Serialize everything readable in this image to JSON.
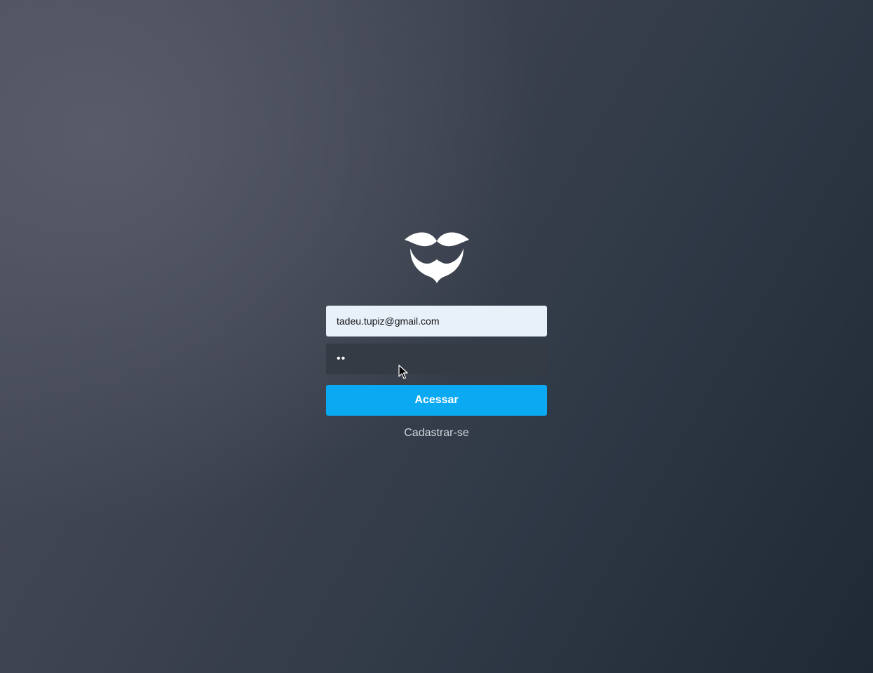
{
  "login": {
    "logo_icon": "mustache-beard-logo-icon",
    "email_value": "tadeu.tupiz@gmail.com",
    "password_value": "ab",
    "submit_label": "Acessar",
    "register_label": "Cadastrar-se"
  },
  "colors": {
    "accent": "#0ba9f2",
    "email_bg": "#e8f0fa",
    "password_bg": "#353b44"
  },
  "cursor_icon": "mouse-pointer-icon"
}
